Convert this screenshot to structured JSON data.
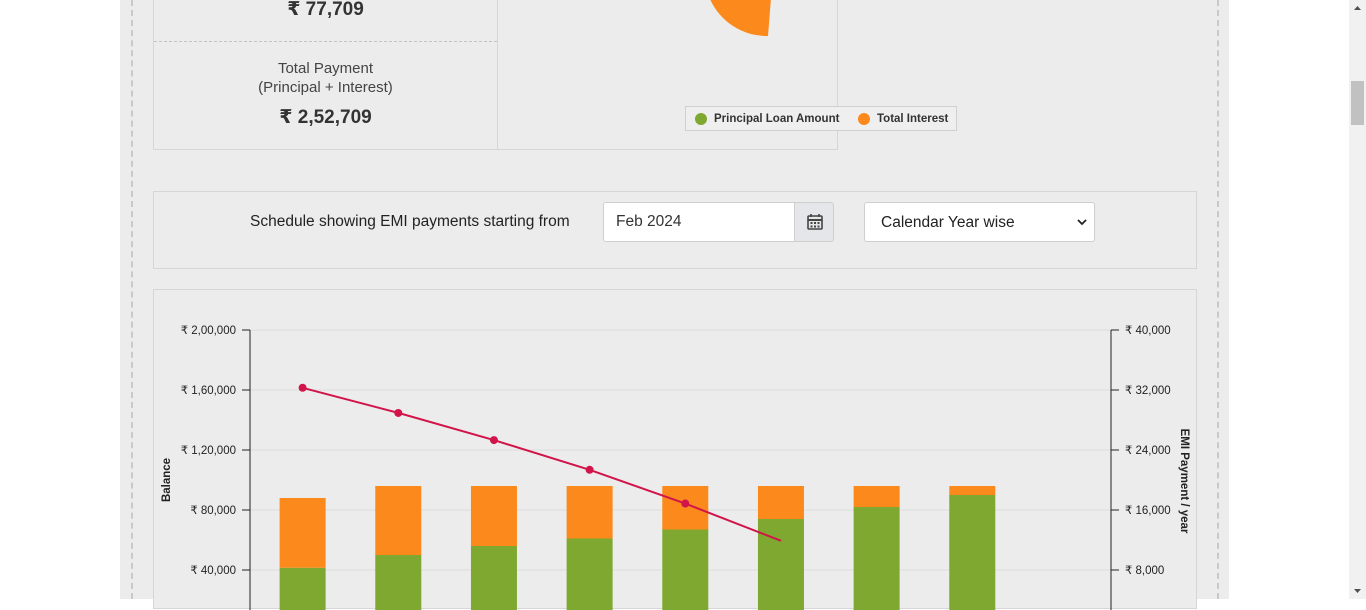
{
  "summary": {
    "interest_value": "₹ 77,709",
    "total_label_line1": "Total Payment",
    "total_label_line2": "(Principal + Interest)",
    "total_value": "₹ 2,52,709"
  },
  "pie": {
    "legend": [
      {
        "label": "Principal Loan Amount",
        "color": "#7ea82f"
      },
      {
        "label": "Total Interest",
        "color": "#fb891b"
      }
    ]
  },
  "schedule": {
    "label": "Schedule showing EMI payments starting from",
    "date_value": "Feb 2024",
    "calendar_icon": "calendar-icon",
    "view_select": "Calendar Year wise"
  },
  "chart_data": {
    "type": "bar",
    "series": [
      {
        "name": "Principal",
        "color": "#7ea82f",
        "values": [
          8300,
          10000,
          11200,
          12200,
          13400,
          14800,
          16400,
          18000
        ]
      },
      {
        "name": "Interest",
        "color": "#fb891b",
        "values": [
          9300,
          9200,
          8000,
          7000,
          5800,
          4400,
          2800,
          1200
        ]
      },
      {
        "name": "Balance",
        "color": "#d1144a",
        "values": [
          161500,
          144700,
          126600,
          106800,
          84300,
          59500
        ]
      }
    ],
    "left_axis": {
      "label": "Balance",
      "ticks": [
        "₹ 2,00,000",
        "₹ 1,60,000",
        "₹ 1,20,000",
        "₹ 80,000",
        "₹ 40,000"
      ],
      "ylim": [
        0,
        200000
      ]
    },
    "right_axis": {
      "label": "EMI Payment / year",
      "ticks": [
        "₹ 40,000",
        "₹ 32,000",
        "₹ 24,000",
        "₹ 16,000",
        "₹ 8,000"
      ],
      "ylim": [
        0,
        40000
      ]
    },
    "grid": true
  }
}
